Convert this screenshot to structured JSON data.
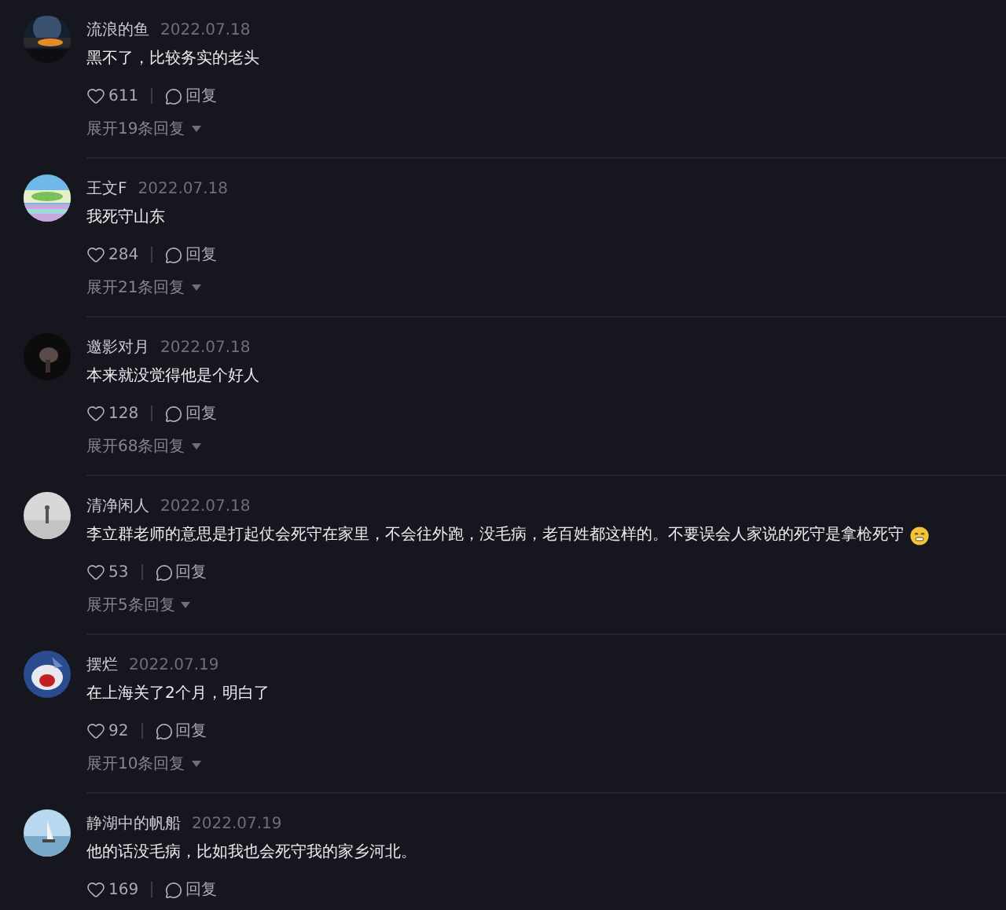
{
  "comments": [
    {
      "author": "流浪的鱼",
      "date": "2022.07.18",
      "text": "黑不了，比较务实的老头",
      "likes": "611",
      "reply": "回复",
      "expand": "展开19条回复"
    },
    {
      "author": "王文F",
      "date": "2022.07.18",
      "text": "我死守山东",
      "likes": "284",
      "reply": "回复",
      "expand": "展开21条回复"
    },
    {
      "author": "邀影对月",
      "date": "2022.07.18",
      "text": "本来就没觉得他是个好人",
      "likes": "128",
      "reply": "回复",
      "expand": "展开68条回复"
    },
    {
      "author": "清净闲人",
      "date": "2022.07.18",
      "text": "李立群老师的意思是打起仗会死守在家里，不会往外跑，没毛病，老百姓都这样的。不要误会人家说的死守是拿枪死守",
      "emoji": true,
      "likes": "53",
      "reply": "回复",
      "expand": "展开5条回复"
    },
    {
      "author": "摆烂",
      "date": "2022.07.19",
      "text": "在上海关了2个月，明白了",
      "likes": "92",
      "reply": "回复",
      "expand": "展开10条回复"
    },
    {
      "author": "静湖中的帆船",
      "date": "2022.07.19",
      "text": "他的话没毛病，比如我也会死守我的家乡河北。",
      "likes": "169",
      "reply": "回复"
    }
  ]
}
